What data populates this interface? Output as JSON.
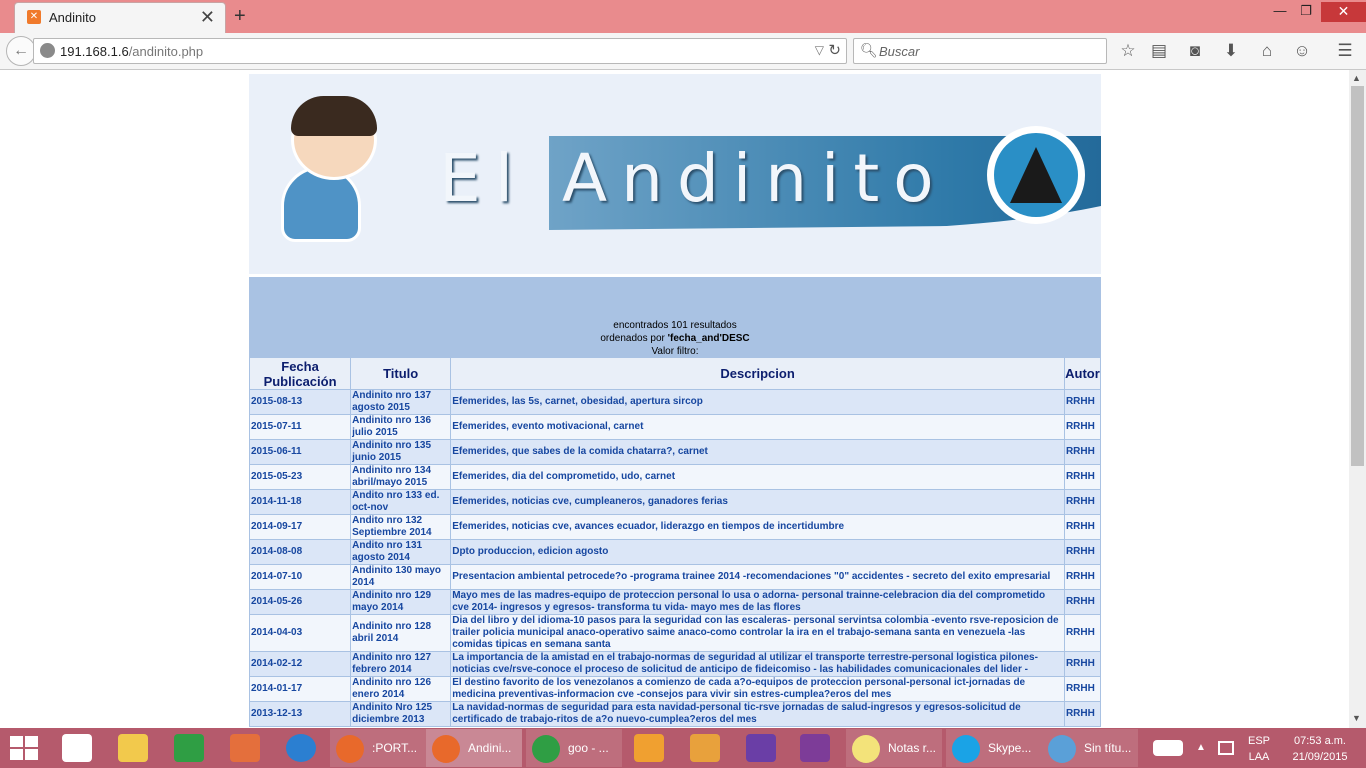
{
  "browser": {
    "tab_title": "Andinito",
    "url_host": "191.168.1.6",
    "url_path": "/andinito.php",
    "search_placeholder": "Buscar"
  },
  "banner": {
    "title": "El Andinito"
  },
  "results": {
    "line1": "encontrados 101 resultados",
    "line2_prefix": "ordenados por ",
    "line2_bold": "'fecha_and'DESC",
    "line3": "Valor filtro:"
  },
  "table": {
    "headers": [
      "Fecha Publicación",
      "Titulo",
      "Descripcion",
      "Autor"
    ],
    "rows": [
      {
        "fecha": "2015-08-13",
        "titulo": "Andinito nro 137 agosto 2015",
        "descripcion": "Efemerides, las 5s, carnet, obesidad, apertura sircop",
        "autor": "RRHH"
      },
      {
        "fecha": "2015-07-11",
        "titulo": "Andinito nro 136 julio 2015",
        "descripcion": "Efemerides, evento motivacional, carnet",
        "autor": "RRHH"
      },
      {
        "fecha": "2015-06-11",
        "titulo": "Andinito nro 135 junio 2015",
        "descripcion": "Efemerides, que sabes de la comida chatarra?, carnet",
        "autor": "RRHH"
      },
      {
        "fecha": "2015-05-23",
        "titulo": "Andinito nro 134 abril/mayo 2015",
        "descripcion": "Efemerides, dia del comprometido, udo, carnet",
        "autor": "RRHH"
      },
      {
        "fecha": "2014-11-18",
        "titulo": "Andito nro 133 ed. oct-nov",
        "descripcion": "Efemerides, noticias cve, cumpleaneros, ganadores ferias",
        "autor": "RRHH"
      },
      {
        "fecha": "2014-09-17",
        "titulo": "Andito nro 132 Septiembre 2014",
        "descripcion": "Efemerides, noticias cve, avances ecuador, liderazgo en tiempos de incertidumbre",
        "autor": "RRHH"
      },
      {
        "fecha": "2014-08-08",
        "titulo": "Andito nro 131 agosto 2014",
        "descripcion": "Dpto produccion, edicion agosto",
        "autor": "RRHH"
      },
      {
        "fecha": "2014-07-10",
        "titulo": "Andinito 130 mayo 2014",
        "descripcion": "Presentacion ambiental petrocede?o -programa trainee 2014 -recomendaciones \"0\" accidentes - secreto del exito empresarial",
        "autor": "RRHH"
      },
      {
        "fecha": "2014-05-26",
        "titulo": "Andinito nro 129 mayo 2014",
        "descripcion": "Mayo mes de las madres-equipo de proteccion personal lo usa o adorna- personal trainne-celebracion dia del comprometido cve 2014- ingresos y egresos- transforma tu vida- mayo mes de las flores",
        "autor": "RRHH"
      },
      {
        "fecha": "2014-04-03",
        "titulo": "Andinito nro 128 abril 2014",
        "descripcion": "Dia del libro y del idioma-10 pasos para la seguridad con las escaleras- personal servintsa colombia -evento rsve-reposicion de trailer policia municipal anaco-operativo saime anaco-como controlar la ira en el trabajo-semana santa en venezuela -las comidas tipicas en semana santa",
        "autor": "RRHH"
      },
      {
        "fecha": "2014-02-12",
        "titulo": "Andinito nro 127 febrero 2014",
        "descripcion": "La importancia de la amistad en el trabajo-normas de seguridad al utilizar el transporte terrestre-personal logistica pilones-noticias cve/rsve-conoce el proceso de solicitud de anticipo de fideicomiso - las habilidades comunicacionales del lider -",
        "autor": "RRHH"
      },
      {
        "fecha": "2014-01-17",
        "titulo": "Andinito nro 126 enero 2014",
        "descripcion": "El destino favorito de los venezolanos a comienzo de cada a?o-equipos de proteccion personal-personal ict-jornadas de medicina preventivas-informacion cve -consejos para vivir sin estres-cumplea?eros del mes",
        "autor": "RRHH"
      },
      {
        "fecha": "2013-12-13",
        "titulo": "Andinito Nro 125 diciembre 2013",
        "descripcion": "La navidad-normas de seguridad para esta navidad-personal tic-rsve jornadas de salud-ingresos y egresos-solicitud de certificado de trabajo-ritos de a?o nuevo-cumplea?eros del mes",
        "autor": "RRHH"
      }
    ]
  },
  "taskbar": {
    "items": [
      {
        "label": ":PORT...",
        "icon": "firefox-icon",
        "color": "#e8692b"
      },
      {
        "label": "Andini...",
        "icon": "firefox-icon",
        "color": "#e8692b"
      },
      {
        "label": "goo - ...",
        "icon": "chrome-icon",
        "color": "#2f9e44"
      },
      {
        "label": "Notas r...",
        "icon": "sticky-notes-icon",
        "color": "#f3e37a"
      },
      {
        "label": "Skype...",
        "icon": "skype-icon",
        "color": "#1aa3e6"
      },
      {
        "label": "Sin títu...",
        "icon": "paint-icon",
        "color": "#5aa0d8"
      }
    ],
    "lang_top": "ESP",
    "lang_bottom": "LAA",
    "time": "07:53 a.m.",
    "date": "21/09/2015"
  }
}
